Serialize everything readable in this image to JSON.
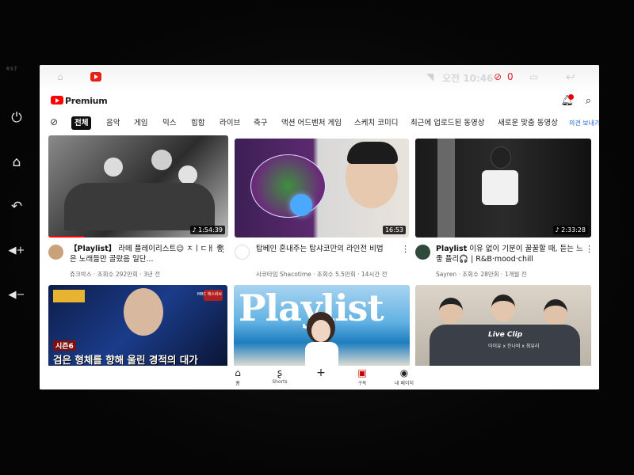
{
  "status_bar": {
    "time": "오전 10:46",
    "count": "0"
  },
  "header": {
    "brand": "Premium",
    "notification_count": "1"
  },
  "chips": [
    "전체",
    "음악",
    "게임",
    "믹스",
    "힙합",
    "라이브",
    "축구",
    "액션 어드벤처 게임",
    "스케치 코미디",
    "최근에 업로드된 동영상",
    "새로운 맞춤 동영상",
    "의견 보내기"
  ],
  "videos": [
    {
      "title_prefix": "【Playlist】",
      "title": "라떼 플레이리스트😉 ㅈㅣㄷㅐ 좋은 노래들만 골랐음 일단...",
      "channel": "쥬크박스",
      "meta": "조회수 292만회 · 3년 전",
      "duration": "♪ 1:54:39",
      "watch_progress": 0.2
    },
    {
      "title": "탑베인 혼내주는 탑샤코만의 라인전 비법",
      "channel": "사코타임 Shacotime",
      "meta": "조회수 5.5만회 · 14시간 전",
      "duration": "16:53"
    },
    {
      "title_prefix": "Playlist",
      "title": "이유 없이 기분이 꿀꿀할 때, 듣는 느좋 플리🎧 | R&B·mood·chill",
      "channel": "Sayren",
      "meta": "조회수 28만회 · 1개월 전",
      "duration": "♪ 2:33:28"
    }
  ],
  "shorts_row": [
    {
      "badge": "시즌6",
      "caption": "검은 형체를 향해 울린 경적의 대가",
      "corner": "MBC 에스비브"
    },
    {
      "caption": "Playlist"
    },
    {
      "caption": "Live Clip",
      "sub": "아이유 x 잔나비 x 최유리"
    }
  ],
  "bottom_nav": [
    {
      "icon": "⌂",
      "label": "홈"
    },
    {
      "icon": "ʂ",
      "label": "Shorts"
    },
    {
      "icon": "+",
      "label": ""
    },
    {
      "icon": "▣",
      "label": "구독"
    },
    {
      "icon": "◉",
      "label": "내 페이지"
    }
  ],
  "colors": {
    "accent": "#ff0000",
    "chip_active": "#0f0f0f",
    "link": "#1a67d2"
  },
  "hardware_buttons": [
    "power-icon",
    "home-icon",
    "back-icon",
    "volume-up-icon",
    "volume-down-icon"
  ]
}
